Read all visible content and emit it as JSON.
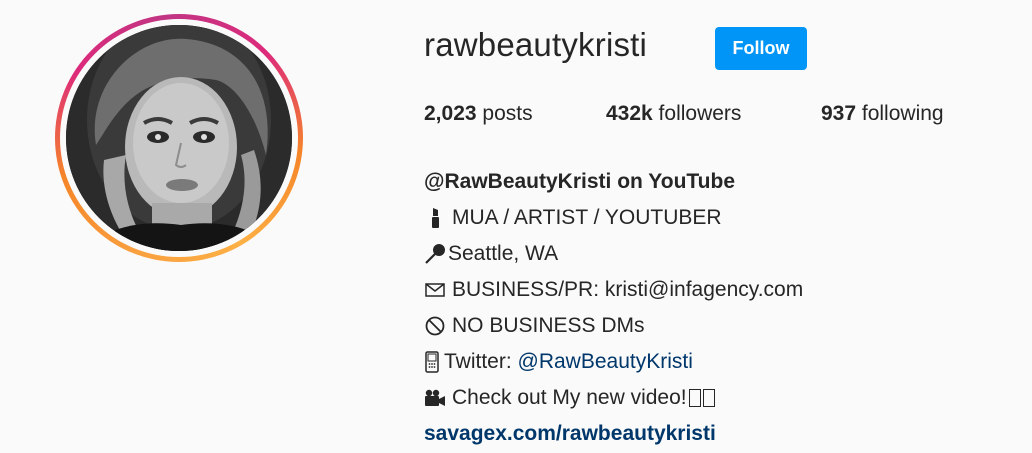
{
  "profile": {
    "username": "rawbeautykristi",
    "follow_label": "Follow"
  },
  "stats": {
    "posts_count": "2,023",
    "posts_label": " posts",
    "followers_count": "432k",
    "followers_label": " followers",
    "following_count": "937",
    "following_label": " following"
  },
  "bio": {
    "name": "@RawBeautyKristi on YouTube",
    "line1_icon": "lipstick-icon",
    "line1_text": "MUA / ARTIST / YOUTUBER",
    "line2_icon": "pin-icon",
    "line2_text": "Seattle, WA",
    "line3_icon": "envelope-icon",
    "line3_text": "BUSINESS/PR: kristi@infagency.com",
    "line4_icon": "prohibited-icon",
    "line4_text": "NO BUSINESS DMs",
    "line5_icon": "phone-icon",
    "line5_prefix": "Twitter: ",
    "line5_link": "@RawBeautyKristi",
    "line6_icon": "video-camera-icon",
    "line6_text": "Check out My new video!",
    "url": "savagex.com/rawbeautykristi"
  },
  "colors": {
    "follow_button": "#0095f6",
    "link": "#00376b",
    "ring_start": "#f58529",
    "ring_end": "#c13584"
  }
}
